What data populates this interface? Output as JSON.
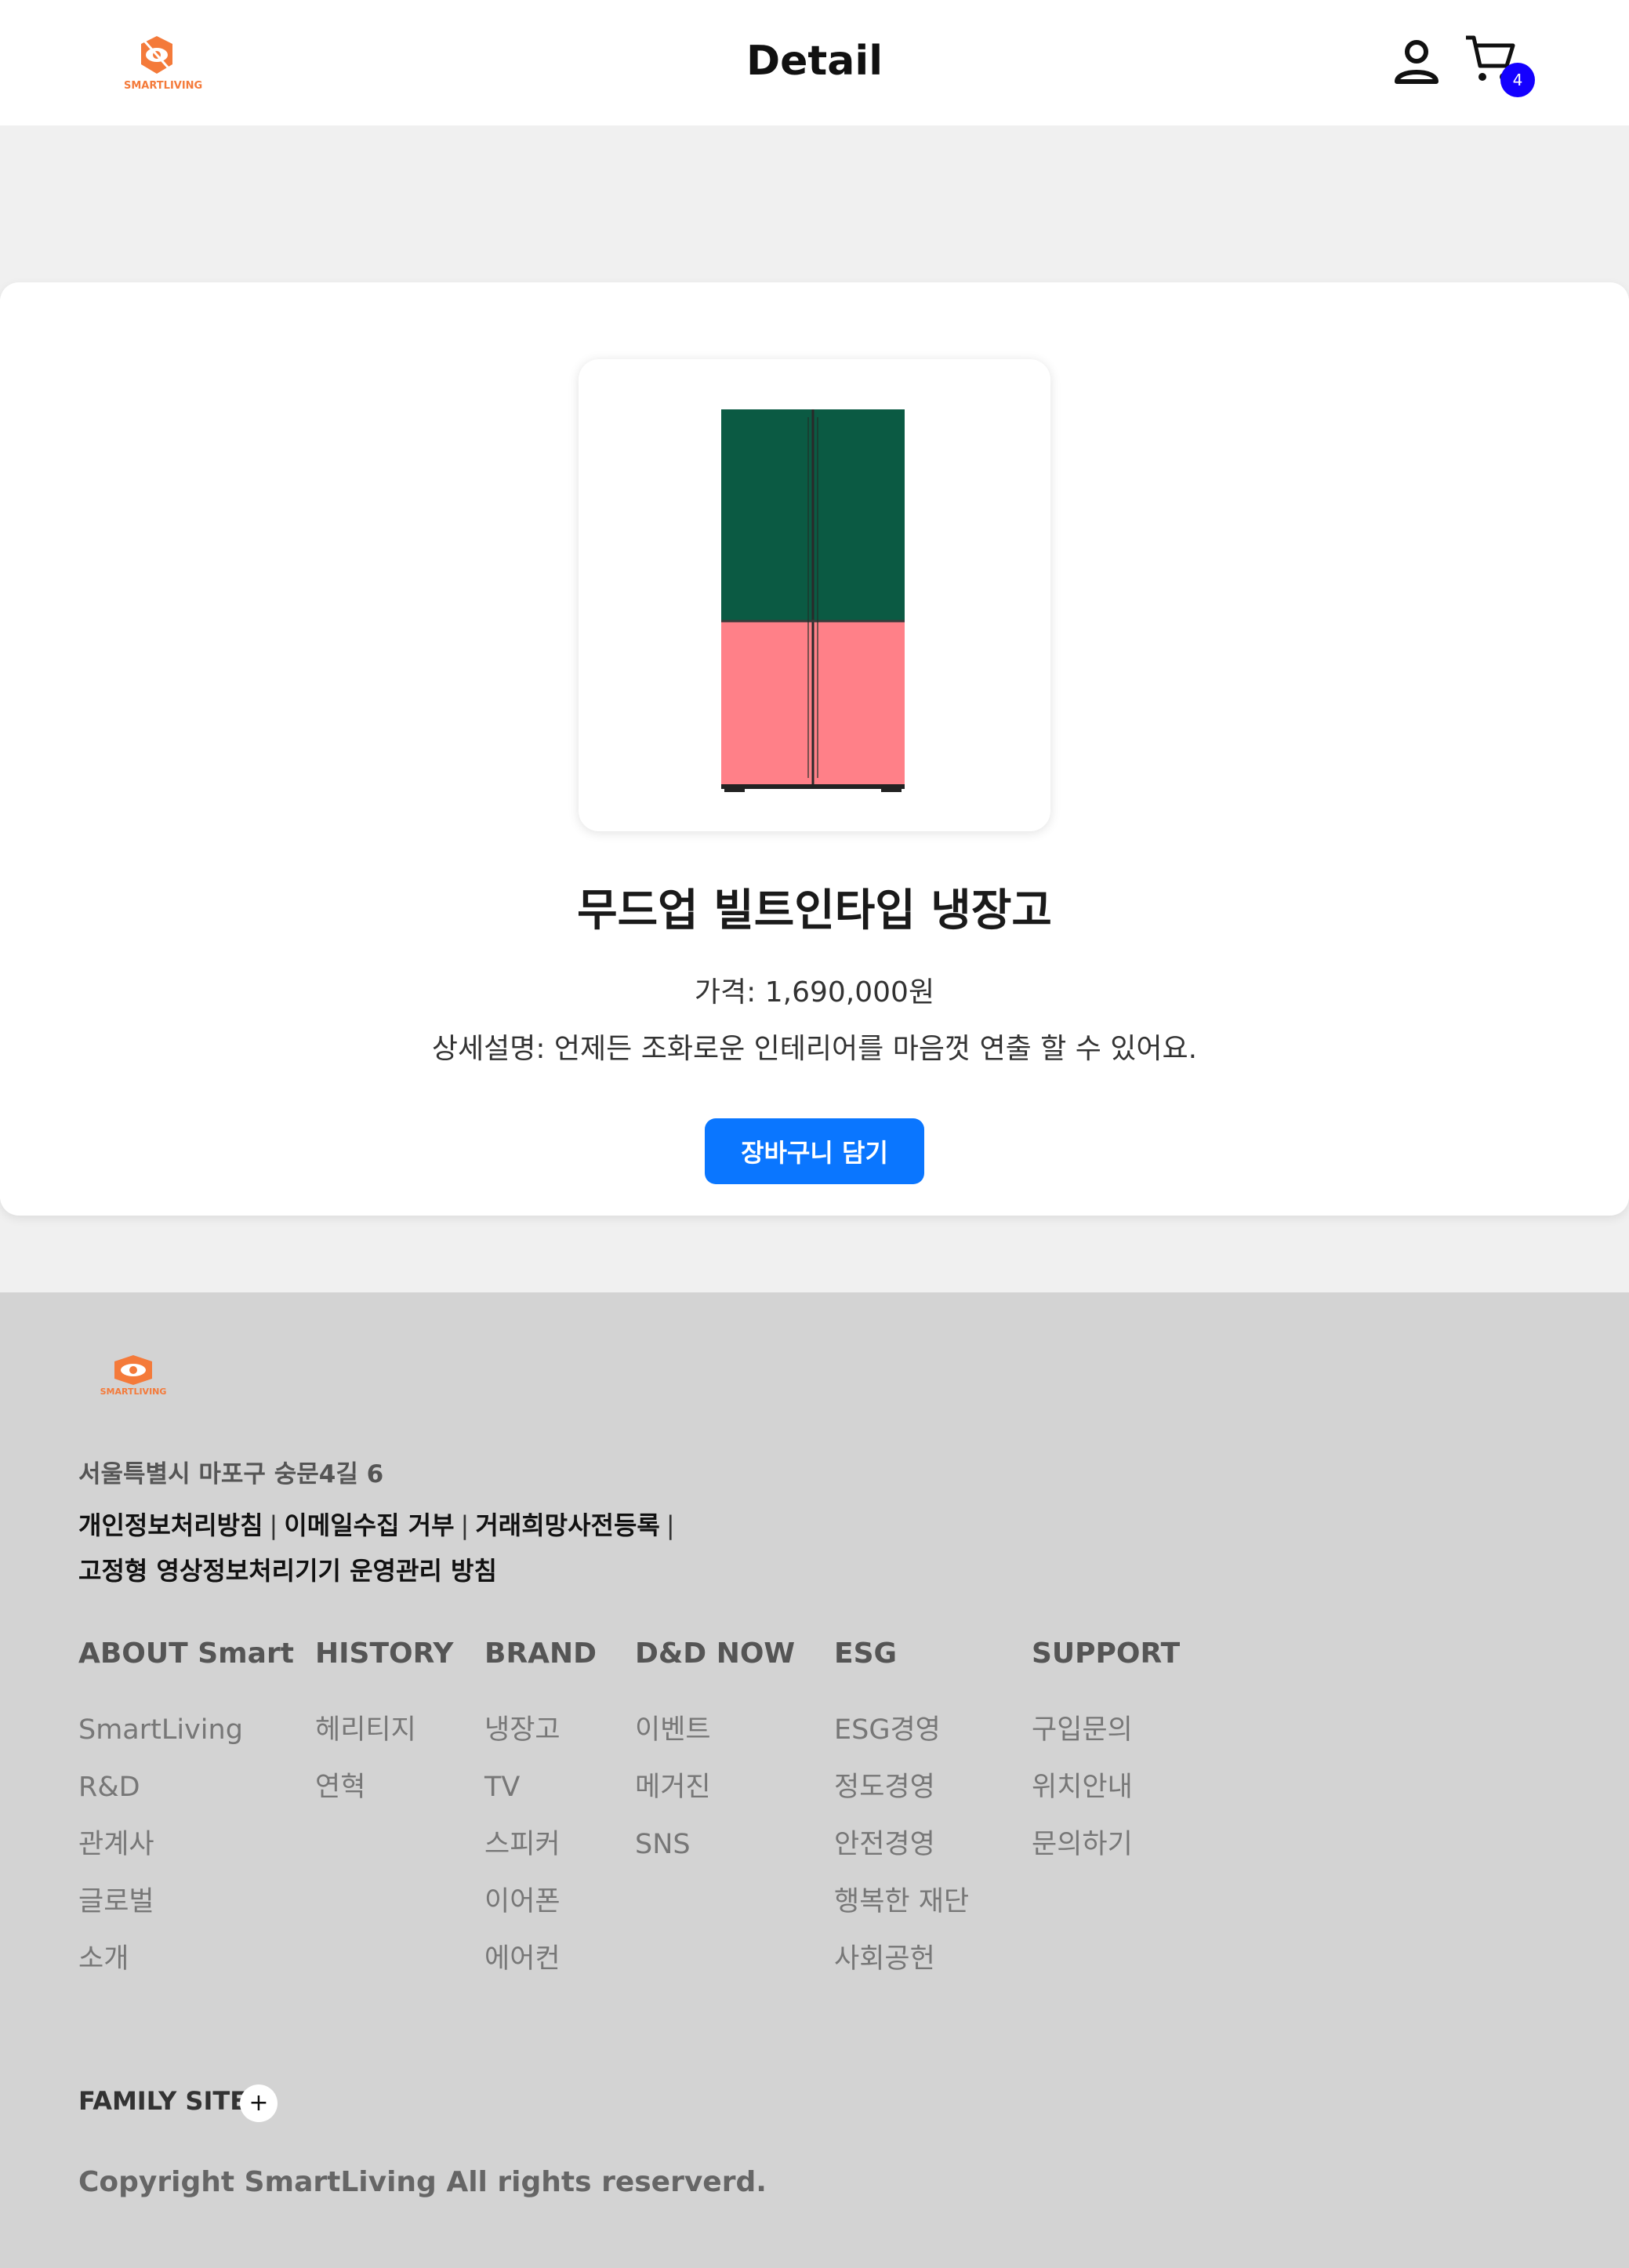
{
  "header": {
    "logo_text": "SMARTLIVING",
    "title": "Detail",
    "cart_count": "4",
    "user_icon": "user-icon",
    "cart_icon": "cart-icon"
  },
  "product": {
    "name": "무드업 빌트인타입 냉장고",
    "price": "가격: 1,690,000원",
    "description": "상세설명: 언제든 조화로운 인테리어를 마음껏 연출 할 수 있어요.",
    "add_to_cart_label": "장바구니 담기",
    "colors": {
      "top": "#0b5a43",
      "bottom": "#ff8088"
    }
  },
  "footer": {
    "logo_text": "SMARTLIVING",
    "address": "서울특별시 마포구 숭문4길 6",
    "policies": [
      "개인정보처리방침",
      "이메일수집 거부",
      "거래희망사전등록",
      "고정형 영상정보처리기기 운영관리 방침"
    ],
    "columns": [
      {
        "title": "ABOUT Smart",
        "items": [
          "SmartLiving",
          "R&D",
          "관계사",
          "글로벌",
          "소개"
        ]
      },
      {
        "title": "HISTORY",
        "items": [
          "헤리티지",
          "연혁"
        ]
      },
      {
        "title": "BRAND",
        "items": [
          "냉장고",
          "TV",
          "스피커",
          "이어폰",
          "에어컨"
        ]
      },
      {
        "title": "D&D NOW",
        "items": [
          "이벤트",
          "메거진",
          "SNS"
        ]
      },
      {
        "title": "ESG",
        "items": [
          "ESG경영",
          "정도경영",
          "안전경영",
          "행복한 재단",
          "사회공헌"
        ]
      },
      {
        "title": "SUPPORT",
        "items": [
          "구입문의",
          "위치안내",
          "문의하기"
        ]
      }
    ],
    "family_site_label": "FAMILY SITE",
    "family_site_button": "+",
    "copyright": "Copyright SmartLiving All rights reserverd."
  },
  "colors": {
    "accent": "#0a76ff",
    "badge": "#1400ff",
    "logo": "#f47a3a",
    "footer_bg": "#d3d3d3"
  }
}
